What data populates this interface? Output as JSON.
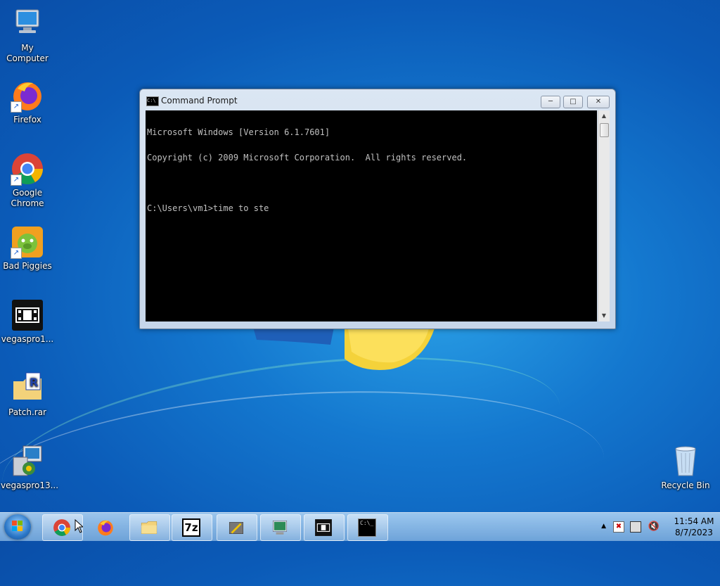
{
  "desktop": {
    "icons": [
      {
        "label": "My Computer"
      },
      {
        "label": "Firefox"
      },
      {
        "label": "Google Chrome"
      },
      {
        "label": "Bad Piggies"
      },
      {
        "label": "vegaspro1..."
      },
      {
        "label": "Patch.rar"
      },
      {
        "label": "vegaspro13..."
      },
      {
        "label": "Recycle Bin"
      }
    ]
  },
  "window": {
    "title": "Command Prompt",
    "lines": [
      "Microsoft Windows [Version 6.1.7601]",
      "Copyright (c) 2009 Microsoft Corporation.  All rights reserved.",
      "",
      "C:\\Users\\vm1>time to ste"
    ],
    "icon": "cmd-icon"
  },
  "taskbar": {
    "apps": [
      {
        "name": "chrome-icon"
      },
      {
        "name": "firefox-icon"
      },
      {
        "name": "explorer-icon"
      },
      {
        "name": "7zip-icon"
      },
      {
        "name": "installer-icon"
      },
      {
        "name": "device-manager-icon"
      },
      {
        "name": "vegas-icon"
      },
      {
        "name": "cmd-icon"
      }
    ],
    "sevenzip_label": "7z",
    "cmd_label": "C:\\_",
    "clock_time": "11:54 AM",
    "clock_date": "8/7/2023"
  },
  "colors": {
    "accent": "#1478cf",
    "console_bg": "#000000",
    "console_text": "#c0c0c0"
  }
}
